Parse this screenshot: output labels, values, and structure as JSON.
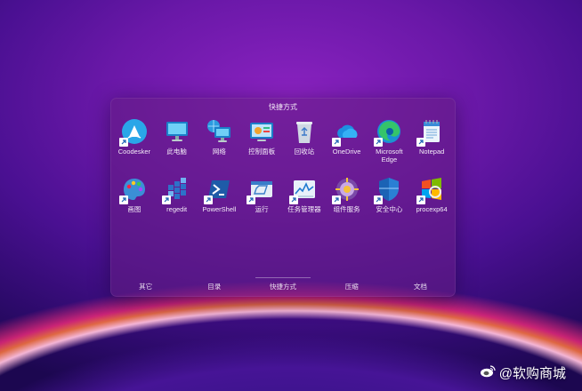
{
  "panel": {
    "title": "快捷方式",
    "rows": [
      [
        {
          "label": "Coodesker",
          "icon": "coodesker-icon",
          "shortcut": true
        },
        {
          "label": "此电脑",
          "icon": "computer-icon",
          "shortcut": false
        },
        {
          "label": "网络",
          "icon": "network-icon",
          "shortcut": false
        },
        {
          "label": "控制面板",
          "icon": "control-panel-icon",
          "shortcut": false
        },
        {
          "label": "回收站",
          "icon": "recycle-bin-icon",
          "shortcut": false
        },
        {
          "label": "OneDrive",
          "icon": "onedrive-icon",
          "shortcut": true
        },
        {
          "label": "Microsoft Edge",
          "icon": "edge-icon",
          "shortcut": true
        },
        {
          "label": "Notepad",
          "icon": "notepad-icon",
          "shortcut": true
        }
      ],
      [
        {
          "label": "画图",
          "icon": "paint-icon",
          "shortcut": true
        },
        {
          "label": "regedit",
          "icon": "regedit-icon",
          "shortcut": true
        },
        {
          "label": "PowerShell",
          "icon": "powershell-icon",
          "shortcut": true
        },
        {
          "label": "运行",
          "icon": "run-icon",
          "shortcut": true
        },
        {
          "label": "任务管理器",
          "icon": "task-manager-icon",
          "shortcut": true
        },
        {
          "label": "组件服务",
          "icon": "component-services-icon",
          "shortcut": true
        },
        {
          "label": "安全中心",
          "icon": "security-center-icon",
          "shortcut": true
        },
        {
          "label": "procexp64",
          "icon": "procexp-icon",
          "shortcut": true
        }
      ]
    ],
    "tabs": [
      {
        "label": "其它",
        "active": false
      },
      {
        "label": "目录",
        "active": false
      },
      {
        "label": "快捷方式",
        "active": true
      },
      {
        "label": "压缩",
        "active": false
      },
      {
        "label": "文档",
        "active": false
      }
    ]
  },
  "watermark": {
    "text": "@软购商城",
    "icon": "weibo-icon"
  },
  "colors": {
    "panel": "#64208a",
    "background": "#5a14a0",
    "accent_glow": "#ff6a3c"
  }
}
